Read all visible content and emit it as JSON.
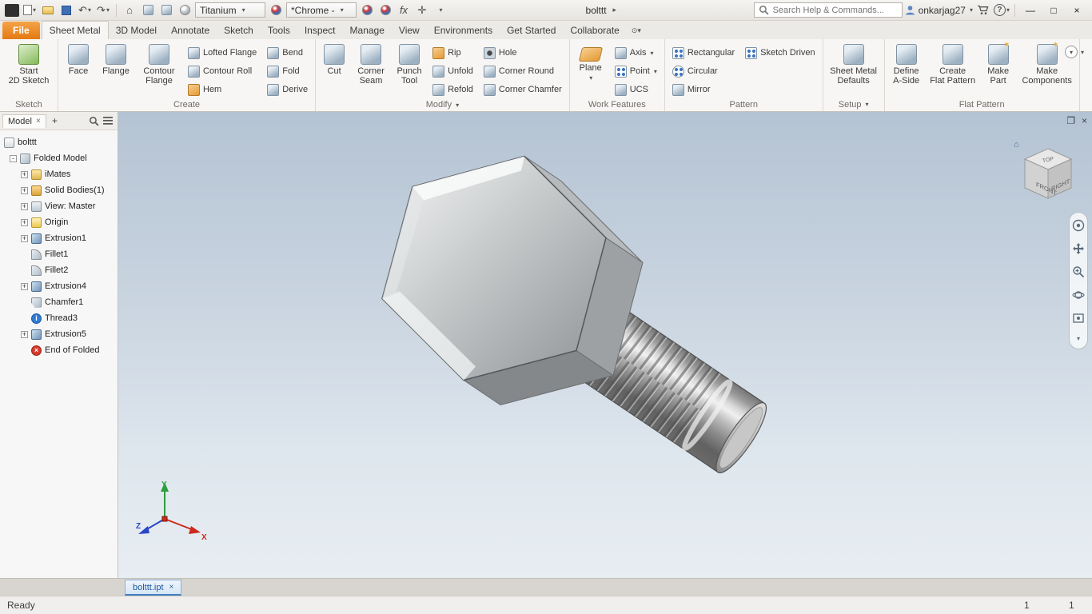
{
  "titlebar": {
    "doc_title": "bolttt",
    "workspace": "Titanium",
    "appearance": "*Chrome -",
    "fx_label": "fx",
    "search_placeholder": "Search Help & Commands...",
    "username": "onkarjag27"
  },
  "ribbon": {
    "active_tab": "Sheet Metal",
    "tabs": [
      "File",
      "Sheet Metal",
      "3D Model",
      "Annotate",
      "Sketch",
      "Tools",
      "Inspect",
      "Manage",
      "View",
      "Environments",
      "Get Started",
      "Collaborate"
    ],
    "panels": [
      {
        "title": "Sketch",
        "bigs": [
          {
            "l1": "Start",
            "l2": "2D Sketch"
          }
        ]
      },
      {
        "title": "Create",
        "bigs": [
          {
            "l1": "Face",
            "l2": ""
          },
          {
            "l1": "Flange",
            "l2": ""
          },
          {
            "l1": "Contour",
            "l2": "Flange"
          }
        ],
        "col1": [
          "Lofted Flange",
          "Contour Roll",
          "Hem"
        ],
        "col2": [
          "Bend",
          "Fold",
          "Derive"
        ]
      },
      {
        "title": "Modify",
        "bigs": [
          {
            "l1": "Cut",
            "l2": ""
          },
          {
            "l1": "Corner",
            "l2": "Seam"
          },
          {
            "l1": "Punch",
            "l2": "Tool"
          }
        ],
        "col1": [
          "Rip",
          "Unfold",
          "Refold"
        ],
        "col2": [
          "Hole",
          "Corner Round",
          "Corner Chamfer"
        ]
      },
      {
        "title": "Work Features",
        "bigs": [
          {
            "l1": "Plane",
            "l2": ""
          }
        ],
        "col1": [
          "Axis",
          "Point",
          "UCS"
        ]
      },
      {
        "title": "Pattern",
        "col1": [
          "Rectangular",
          "Circular",
          "Mirror"
        ],
        "col2": [
          "Sketch Driven"
        ]
      },
      {
        "title": "Setup",
        "bigs": [
          {
            "l1": "Sheet Metal",
            "l2": "Defaults"
          }
        ]
      },
      {
        "title": "Flat Pattern",
        "bigs": [
          {
            "l1": "Define",
            "l2": "A-Side"
          },
          {
            "l1": "Create",
            "l2": "Flat Pattern"
          },
          {
            "l1": "Make",
            "l2": "Part"
          },
          {
            "l1": "Make",
            "l2": "Components"
          }
        ]
      }
    ]
  },
  "browser": {
    "tab_label": "Model",
    "tree": [
      {
        "label": "bolttt"
      },
      {
        "label": "Folded Model"
      },
      {
        "label": "iMates"
      },
      {
        "label": "Solid Bodies(1)"
      },
      {
        "label": "View: Master"
      },
      {
        "label": "Origin"
      },
      {
        "label": "Extrusion1"
      },
      {
        "label": "Fillet1"
      },
      {
        "label": "Fillet2"
      },
      {
        "label": "Extrusion4"
      },
      {
        "label": "Chamfer1"
      },
      {
        "label": "Thread3"
      },
      {
        "label": "Extrusion5"
      },
      {
        "label": "End of Folded"
      }
    ]
  },
  "viewport": {
    "viewcube": {
      "top": "TOP",
      "front": "FRONT",
      "right": "RIGHT"
    },
    "doc_tab": "bolttt.ipt",
    "axis_labels": {
      "x": "X",
      "y": "Y",
      "z": "Z"
    }
  },
  "statusbar": {
    "status": "Ready",
    "count_left": "1",
    "count_right": "1"
  },
  "icons": {
    "search": "magnifier",
    "browser_menu": "hamburger",
    "user": "person-silhouette",
    "cart": "shopping-cart",
    "help": "question-circle",
    "window": "minimize / maximize / close",
    "viewcube_home": "house"
  }
}
